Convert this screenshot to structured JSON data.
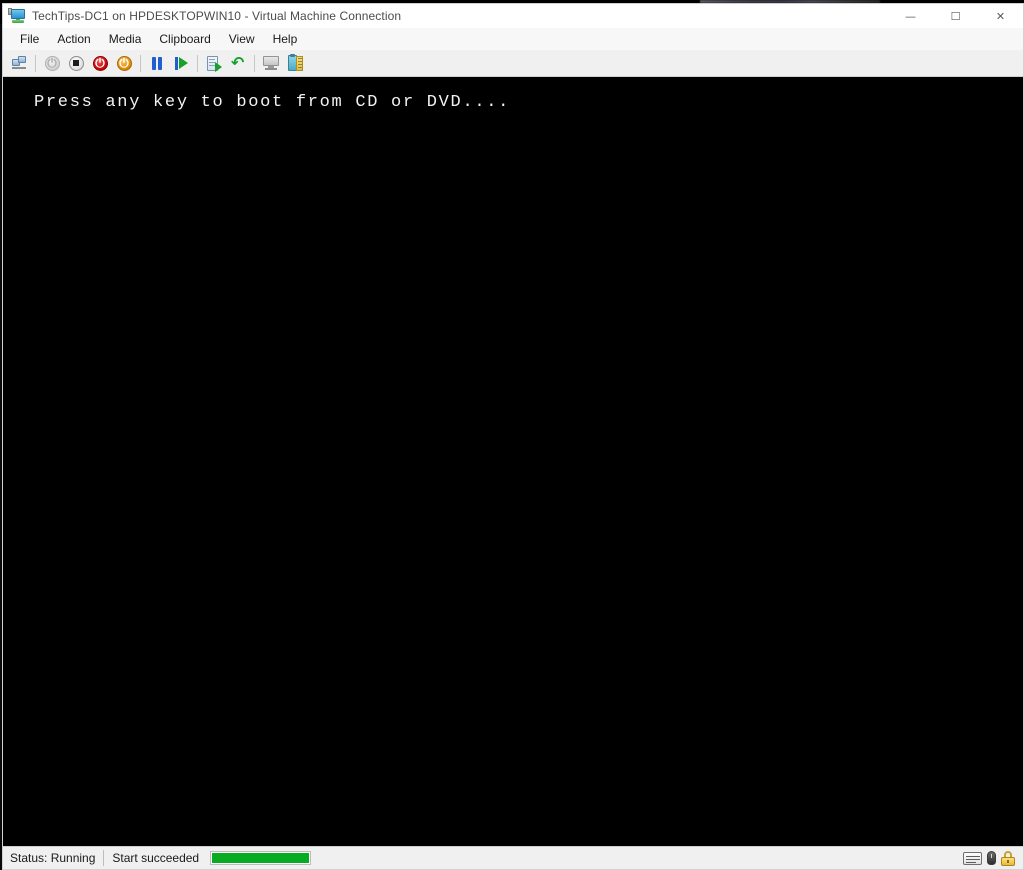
{
  "window": {
    "title": "TechTips-DC1 on HPDESKTOPWIN10 - Virtual Machine Connection",
    "app_icon": "virtual-machine-icon",
    "controls": {
      "minimize": "—",
      "maximize": "☐",
      "close": "✕"
    }
  },
  "menu": {
    "items": [
      {
        "label": "File"
      },
      {
        "label": "Action"
      },
      {
        "label": "Media"
      },
      {
        "label": "Clipboard"
      },
      {
        "label": "View"
      },
      {
        "label": "Help"
      }
    ]
  },
  "toolbar": {
    "buttons": [
      {
        "name": "ctrl-alt-delete-icon",
        "title": "Ctrl+Alt+Delete"
      },
      {
        "name": "start-icon",
        "title": "Start"
      },
      {
        "name": "turn-off-icon",
        "title": "Turn Off"
      },
      {
        "name": "shut-down-icon",
        "title": "Shut Down"
      },
      {
        "name": "reset-icon",
        "title": "Reset"
      },
      {
        "name": "pause-icon",
        "title": "Pause"
      },
      {
        "name": "resume-icon",
        "title": "Resume"
      },
      {
        "name": "checkpoint-icon",
        "title": "Checkpoint"
      },
      {
        "name": "revert-icon",
        "title": "Revert"
      },
      {
        "name": "enhanced-session-icon",
        "title": "Enhanced Session"
      },
      {
        "name": "settings-icon",
        "title": "Settings"
      }
    ]
  },
  "console": {
    "text": "Press any key to boot from CD or DVD....",
    "background_color": "#000000",
    "text_color": "#f2f2f2"
  },
  "status_bar": {
    "status_label": "Status: Running",
    "operation_label": "Start succeeded",
    "progress_percent": 100,
    "progress_color": "#07ac22",
    "icons": [
      {
        "name": "keyboard-capture-icon"
      },
      {
        "name": "mouse-capture-icon"
      },
      {
        "name": "lock-icon"
      }
    ]
  }
}
